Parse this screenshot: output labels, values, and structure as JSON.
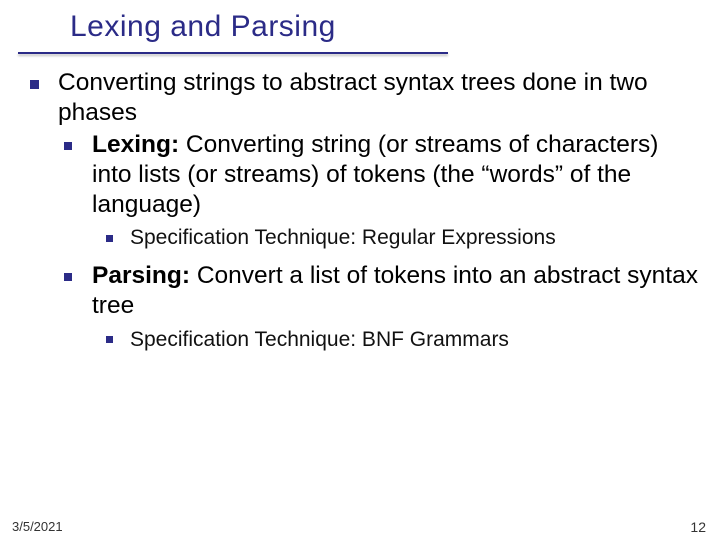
{
  "title": "Lexing and Parsing",
  "bullets": {
    "lvl1": "Converting strings to abstract syntax trees done in two phases",
    "lexing_bold": "Lexing:",
    "lexing_rest": " Converting string (or streams of characters) into lists (or streams) of tokens (the “words” of the language)",
    "lexing_spec": "Specification Technique: Regular Expressions",
    "parsing_bold": "Parsing:",
    "parsing_rest": " Convert a list of tokens into an abstract syntax tree",
    "parsing_spec": "Specification Technique: BNF Grammars"
  },
  "footer": {
    "date": "3/5/2021",
    "page": "12"
  }
}
